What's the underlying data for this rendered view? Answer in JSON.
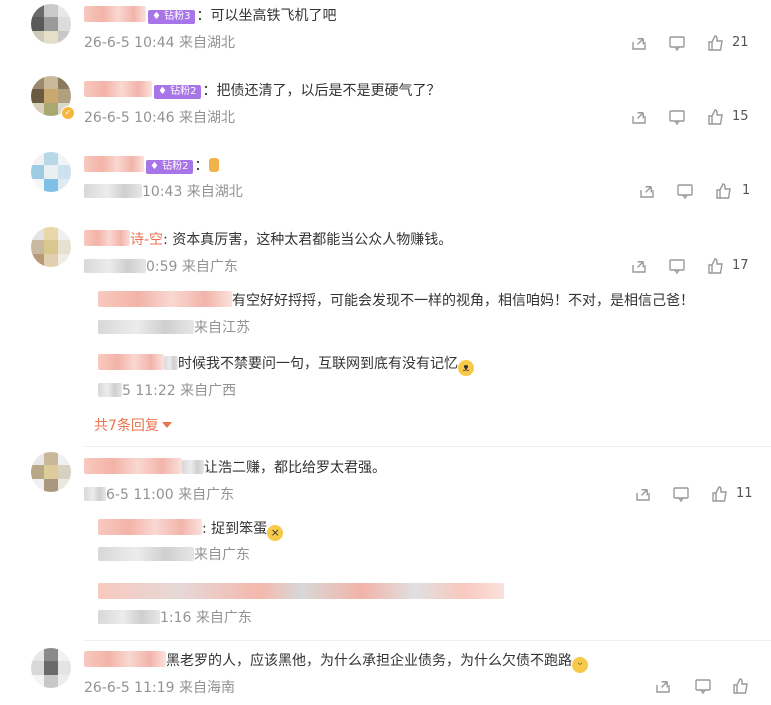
{
  "comments": [
    {
      "badge": "钻粉3",
      "text": "：可以坐高铁飞机了吧",
      "meta": "26-6-5 10:44 来自湖北",
      "likes": "21"
    },
    {
      "badge": "钻粉2",
      "text": "：把债还清了，以后是不是更硬气了？",
      "meta": "26-6-5 10:46 来自湖北",
      "likes": "15"
    },
    {
      "badge": "钻粉2",
      "text": "：",
      "meta": "10:43 来自湖北",
      "likes": "1"
    },
    {
      "name_tail": "诗-空",
      "text": ": 资本真厉害，这种太君都能当公众人物赚钱。",
      "meta": "0:59 来自广东",
      "likes": "17",
      "replies": [
        {
          "text": "有空好好捋捋，可能会发现不一样的视角，相信咱妈！不对，是相信己爸！",
          "meta": "来自江苏"
        },
        {
          "text": "时候我不禁要问一句，互联网到底有没有记忆",
          "meta": "5 11:22 来自广西"
        }
      ],
      "more": "共7条回复"
    },
    {
      "text": "让浩二赚，都比给罗太君强。",
      "meta": "6-5 11:00 来自广东",
      "likes": "11",
      "replies": [
        {
          "text": ": 捉到笨蛋",
          "meta": "来自广东"
        },
        {
          "text": "",
          "meta": "1:16 来自广东"
        }
      ]
    },
    {
      "text": "黑老罗的人，应该黑他，为什么承担企业债务，为什么欠债不跑路",
      "meta": "26-6-5 11:19 来自海南",
      "likes": ""
    }
  ],
  "icons": {
    "share": "share-icon",
    "comment": "comment-icon",
    "like": "thumbs-up-icon",
    "hand": "thumbs-up-emoji",
    "cat": "cat-emoji",
    "laugh": "laughing-emoji",
    "dizzy": "dizzy-face-emoji"
  },
  "colors": {
    "badge": "#a875e8",
    "more": "#eb7350",
    "meta": "#939393"
  }
}
